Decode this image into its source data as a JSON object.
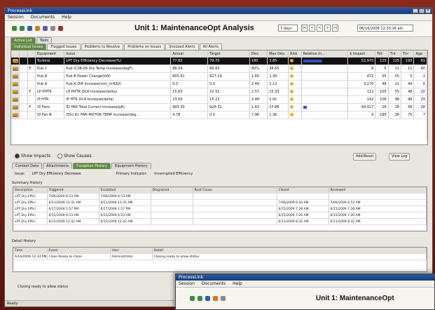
{
  "window": {
    "title": "ProcessLink"
  },
  "menu": [
    "Session",
    "Documents",
    "Help"
  ],
  "toolbar": {
    "title": "Unit 1: MaintenanceOpt Analysis",
    "period": "7 days",
    "nav": [
      "|<",
      "<",
      "<",
      ">",
      ">|"
    ],
    "date": "06/16/2009 12:33:16 am"
  },
  "top_tabs": [
    "Active List",
    "Tools"
  ],
  "sub_tabs": [
    "Individual Issues",
    "Flagged Issues",
    "Problems to Resolve",
    "Problems on Issues",
    "Snoozed Alerts",
    "All Alerts"
  ],
  "grid": {
    "columns": [
      "",
      "",
      "",
      "Equipment",
      "Issue",
      "Actual",
      "Target",
      "Dev.",
      "Max Dev.",
      "Risk",
      "Relative In...",
      "$ Impact",
      "Tot",
      "Tnt",
      "Tnr",
      "Age"
    ],
    "rows": [
      {
        "equip": "Turbine",
        "issue": "LPT Dry Efficiency Decrease(%)",
        "actual": "77.82",
        "target": "79.75",
        "dev": "180",
        "maxdev": "3.85",
        "risk": "#e8b020",
        "rel": 0.55,
        "impact": "52,970",
        "tot": "125",
        "tnt": "125",
        "tnr": "193",
        "age": "61",
        "flag": ""
      },
      {
        "equip": "Pub C",
        "issue": "Pub IC/IB-09 Dry Temp Increase(degF)",
        "actual": "86.09",
        "target": "89.83",
        "dev": "80%",
        "maxdev": "38.65",
        "risk": "#e8b020",
        "rel": 0.0,
        "impact": "8",
        "tot": "5",
        "tnt": "11",
        "tnr": "11",
        "age": "40",
        "flag": "F"
      },
      {
        "equip": "Pub B",
        "issue": "Pub B Power Change(kW)",
        "actual": "605.91",
        "target": "627.19",
        "dev": "1.65",
        "maxdev": "1.39",
        "risk": "#e8b020",
        "rel": 0.0,
        "impact": "472",
        "tot": "55",
        "tnt": "55",
        "tnr": "5",
        "age": "2",
        "flag": ""
      },
      {
        "equip": "Pub A",
        "issue": "Pub A Diff Increase(mm_inH2O)",
        "actual": "0.5",
        "target": "0.0",
        "dev": "2.49",
        "maxdev": "2.13",
        "risk": "#e8b020",
        "rel": 0.0,
        "impact": "3,170",
        "tot": "48",
        "tnt": "21",
        "tnr": "44",
        "age": "6",
        "flag": ""
      },
      {
        "equip": "LP PHTR",
        "issue": "LP PHTR DCA Increase(delta)",
        "actual": "15.63",
        "target": "10.51",
        "dev": "2.57",
        "maxdev": "15.33",
        "risk": "#e8b020",
        "rel": 0.0,
        "impact": "112",
        "tot": "105",
        "tnt": "55",
        "tnr": "48",
        "age": "20",
        "flag": "F"
      },
      {
        "equip": "IP HTR",
        "issue": "IP HTR DCA Increase(delta)",
        "actual": "23.50",
        "target": "15.22",
        "dev": "2.48",
        "maxdev": "2.91",
        "risk": "#e8b020",
        "rel": 0.0,
        "impact": "142",
        "tot": "106",
        "tnt": "98",
        "tnr": "98",
        "age": "29",
        "flag": ""
      },
      {
        "equip": "ID Fans",
        "issue": "ID FAN Total Current Increase(pA)",
        "actual": "905.30",
        "target": "926.31",
        "dev": "1.63",
        "maxdev": "27.86",
        "risk": "#e8b020",
        "rel": 0.1,
        "impact": "94,017",
        "tot": "28",
        "tnt": "28",
        "tnr": "58",
        "age": "28",
        "flag": "F"
      },
      {
        "equip": "ID Fan B",
        "issue": "DSU ID. FAN MOTOR TEMP Increase(deg...",
        "actual": "4.78",
        "target": "0.0",
        "dev": "7.96",
        "maxdev": "1.36",
        "risk": "#e8b020",
        "rel": 0.0,
        "impact": "9",
        "tot": "185",
        "tnt": "26",
        "tnr": "75",
        "age": "7",
        "flag": ""
      }
    ]
  },
  "radios": {
    "impacts": "Show Impacts",
    "causes": "Show Causes"
  },
  "buttons": {
    "add": "Add/Reset",
    "log": "View Log"
  },
  "lower_tabs": [
    "Context Data",
    "Attachments",
    "Exception History",
    "Equipment History"
  ],
  "info": {
    "issue_label": "Issue:",
    "issue_value": "LPT Dry Efficiency Decrease",
    "indicator_label": "Primary Indicator:",
    "indicator_value": "Inverrupted Efficiency"
  },
  "summary_label": "Summary History",
  "history": {
    "columns": [
      "Description",
      "Triggered",
      "Escalated",
      "Diagnosed",
      "Root Cause",
      "Closed",
      "Reviewed"
    ],
    "rows": [
      [
        "LPT Dry Effici",
        "7/06/2009 6:53 AM",
        "7/06/2009 6:53 AM",
        "",
        "",
        "",
        ""
      ],
      [
        "LPT Dry Effici",
        "6/21/2009 12:31 AM",
        "6/21/2009 12:31 AM",
        "",
        "",
        "7/06/2009 6:50 AM",
        "7/06/2009 6:53 AM"
      ],
      [
        "LPT Dry Effici",
        "6/17/2009 1:57 PM",
        "6/17/2009 1:57 PM",
        "",
        "",
        "6/15/2009 7:28 AM",
        "6/15/2009 7:28 AM"
      ],
      [
        "LPT Dry Effici",
        "6/15/2009 6:53 AM",
        "6/15/2009 6:53 AM",
        "",
        "",
        "6/15/2009 7:26 AM",
        "6/15/2009 7:26 AM"
      ],
      [
        "LPT Dry Effici",
        "6/15/2009 12:42 AM",
        "6/15/2009 12:42 AM",
        "",
        "",
        "6/11/2009 8:32 AM",
        "6/11/2009 8:32 AM"
      ]
    ]
  },
  "detail_label": "Detail History",
  "detail": {
    "columns": [
      "Time",
      "Event",
      "User",
      "Detail"
    ],
    "rows": [
      [
        "6/16/2009 12:33 PM",
        "Close Ready to Close",
        "Administrator",
        "Closing ready to allow status"
      ]
    ]
  },
  "status_text": "Closing ready to allow status",
  "statusbar": "Ready",
  "second_window": {
    "title": "ProcessLink",
    "menu": [
      "Session",
      "Documents",
      "Help"
    ],
    "toolbar_title": "Unit 1: MaintenanceOpt"
  }
}
